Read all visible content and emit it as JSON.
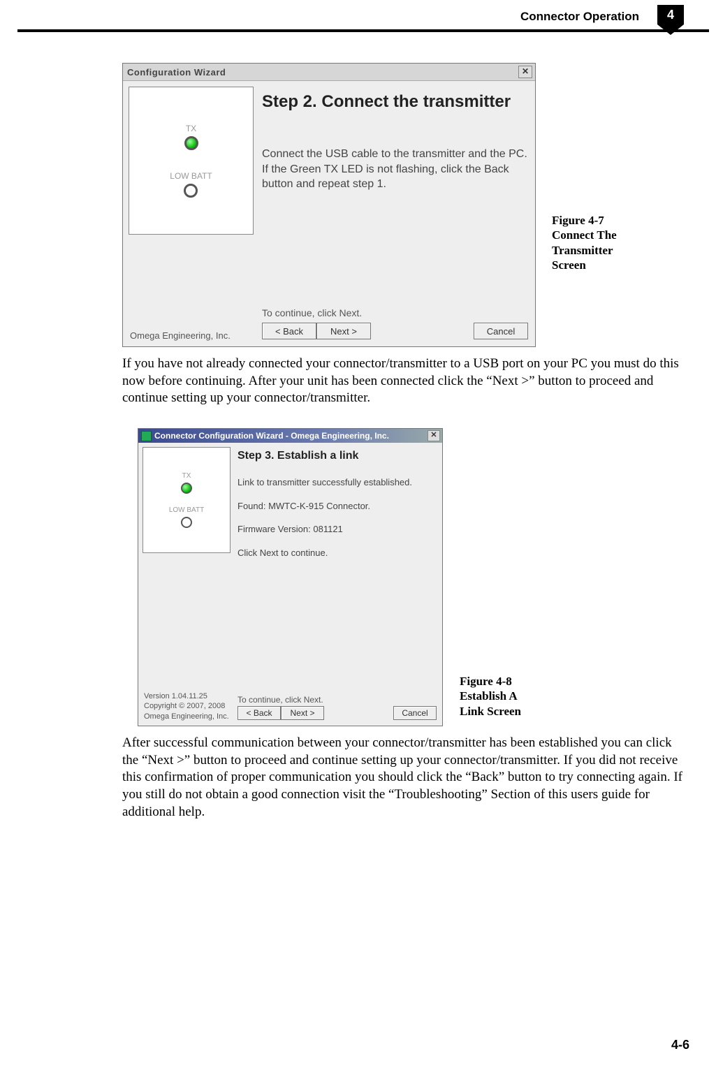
{
  "header": {
    "chapter_title": "Connector Operation",
    "chapter_number": "4"
  },
  "figure1": {
    "caption_line1": "Figure 4-7",
    "caption_line2": "Connect The",
    "caption_line3": "Transmitter",
    "caption_line4": "Screen",
    "titlebar": "Configuration Wizard",
    "close": "✕",
    "tx_label": "TX",
    "lowbatt_label": "LOW BATT",
    "step_title": "Step 2.  Connect the transmitter",
    "step_body": "Connect the USB cable to the transmitter and the PC.  If the Green TX LED is not flashing, click the Back button and repeat step 1.",
    "vendor": "Omega Engineering, Inc.",
    "continue_label": "To continue, click Next.",
    "back_btn": "< Back",
    "next_btn": "Next >",
    "cancel_btn": "Cancel"
  },
  "para1": "If you have not already connected your connector/transmitter to a USB port on your PC you must do this now before continuing. After your unit has been connected click the “Next >” button to proceed and continue setting up your connector/transmitter.",
  "figure2": {
    "caption_line1": "Figure 4-8",
    "caption_line2": "Establish A",
    "caption_line3": "Link Screen",
    "titlebar": "Connector Configuration Wizard - Omega Engineering, Inc.",
    "close": "✕",
    "tx_label": "TX",
    "lowbatt_label": "LOW BATT",
    "step_title": "Step 3.  Establish a link",
    "line1": "Link to transmitter successfully established.",
    "line2": "Found:  MWTC-K-915 Connector.",
    "line3": "Firmware Version:  081121",
    "line4": "Click Next to continue.",
    "version": "Version 1.04.11.25",
    "copyright": "Copyright © 2007, 2008 Omega Engineering, Inc.",
    "continue_label": "To continue, click Next.",
    "back_btn": "< Back",
    "next_btn": "Next >",
    "cancel_btn": "Cancel"
  },
  "para2": "After successful communication between your connector/transmitter has been established you can click the “Next >” button to proceed and continue setting up your connector/transmitter. If you did not receive this confirmation of proper communication you should click the “Back” button to try connecting again. If you still do not obtain a good connection visit the “Troubleshooting” Section of this users guide for additional help.",
  "page_number": "4-6"
}
